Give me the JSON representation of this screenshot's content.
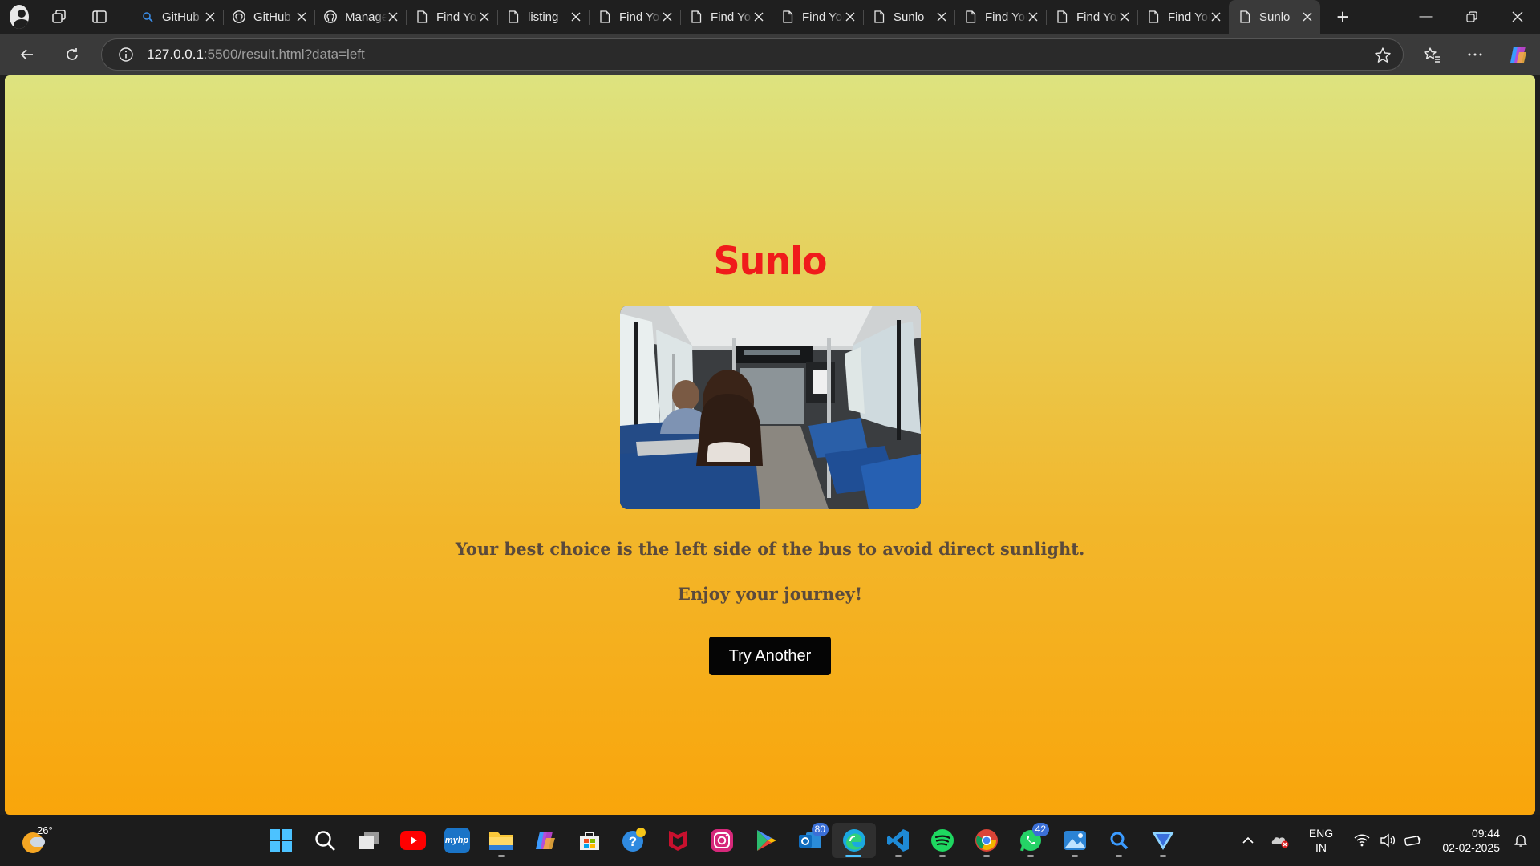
{
  "browser": {
    "tabs": [
      {
        "label": "GitHub",
        "icon": "search-icon"
      },
      {
        "label": "GitHub",
        "icon": "github-icon"
      },
      {
        "label": "Manage",
        "icon": "github-icon"
      },
      {
        "label": "Find Your",
        "icon": "page-icon"
      },
      {
        "label": "listing",
        "icon": "page-icon"
      },
      {
        "label": "Find Your",
        "icon": "page-icon"
      },
      {
        "label": "Find Your",
        "icon": "page-icon"
      },
      {
        "label": "Find Your",
        "icon": "page-icon"
      },
      {
        "label": "Sunlo",
        "icon": "page-icon"
      },
      {
        "label": "Find Your",
        "icon": "page-icon"
      },
      {
        "label": "Find Your",
        "icon": "page-icon"
      },
      {
        "label": "Find Your",
        "icon": "page-icon"
      },
      {
        "label": "Sunlo",
        "icon": "page-icon",
        "active": true
      }
    ],
    "url_host": "127.0.0.1",
    "url_rest": ":5500/result.html?data=left"
  },
  "page": {
    "brand": "Sunlo",
    "image_alt": "Passengers sitting inside a bus",
    "message": "Your best choice is the left side of the bus to avoid direct sunlight.",
    "sub_message": "Enjoy your journey!",
    "button_label": "Try Another"
  },
  "taskbar": {
    "temperature": "26°",
    "apps": [
      {
        "name": "windows-start",
        "badge": ""
      },
      {
        "name": "search",
        "badge": ""
      },
      {
        "name": "task-view",
        "badge": ""
      },
      {
        "name": "youtube",
        "badge": ""
      },
      {
        "name": "myhp",
        "badge": ""
      },
      {
        "name": "file-explorer",
        "badge": ""
      },
      {
        "name": "copilot",
        "badge": ""
      },
      {
        "name": "microsoft-store",
        "badge": ""
      },
      {
        "name": "get-help",
        "badge": ""
      },
      {
        "name": "mcafee",
        "badge": ""
      },
      {
        "name": "instagram",
        "badge": ""
      },
      {
        "name": "play-store",
        "badge": ""
      },
      {
        "name": "outlook",
        "badge": "80"
      },
      {
        "name": "edge",
        "badge": ""
      },
      {
        "name": "vscode",
        "badge": ""
      },
      {
        "name": "spotify",
        "badge": ""
      },
      {
        "name": "chrome",
        "badge": ""
      },
      {
        "name": "whatsapp",
        "badge": "42"
      },
      {
        "name": "photos",
        "badge": ""
      },
      {
        "name": "magnifier",
        "badge": ""
      },
      {
        "name": "proton-vpn",
        "badge": ""
      }
    ],
    "lang_line1": "ENG",
    "lang_line2": "IN",
    "time": "09:44",
    "date": "02-02-2025"
  },
  "colors": {
    "brand_red": "#f01b1b",
    "button_bg": "#050505",
    "gradient_top": "#dde37f",
    "gradient_bottom": "#f9a50b"
  }
}
